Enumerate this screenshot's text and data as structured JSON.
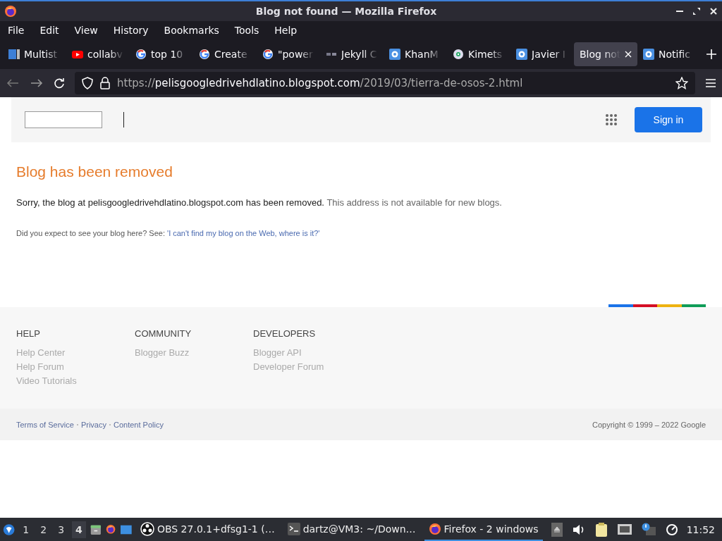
{
  "window": {
    "title": "Blog not found — Mozilla Firefox"
  },
  "menu": [
    "File",
    "Edit",
    "View",
    "History",
    "Bookmarks",
    "Tools",
    "Help"
  ],
  "tabs": [
    {
      "label": "Multist",
      "kind": "tile",
      "selected": false
    },
    {
      "label": "collabv",
      "kind": "play",
      "selected": false
    },
    {
      "label": "top 10",
      "kind": "g",
      "selected": false
    },
    {
      "label": "Create",
      "kind": "g",
      "selected": false
    },
    {
      "label": "\"power",
      "kind": "g",
      "selected": false
    },
    {
      "label": "Jekyll C",
      "kind": "dots",
      "selected": false
    },
    {
      "label": "KhanM",
      "kind": "d",
      "selected": false
    },
    {
      "label": "Kimets",
      "kind": "gear",
      "selected": false
    },
    {
      "label": "Javier I",
      "kind": "d",
      "selected": false
    },
    {
      "label": "Blog not",
      "kind": "none",
      "selected": true
    },
    {
      "label": "Notific",
      "kind": "d",
      "selected": false
    }
  ],
  "address": {
    "scheme": "https://",
    "domain": "pelisgoogledrivehdlatino.blogspot.com",
    "path": "/2019/03/tierra-de-osos-2.html"
  },
  "page": {
    "sign_in": "Sign in",
    "heading": "Blog has been removed",
    "message": "Sorry, the blog at pelisgoogledrivehdlatino.blogspot.com has been removed.",
    "message_note": "This address is not available for new blogs.",
    "help_prompt": "Did you expect to see your blog here? See:",
    "help_link": "'I can't find my blog on the Web, where is it?'",
    "footer_columns": [
      {
        "heading": "HELP",
        "links": [
          "Help Center",
          "Help Forum",
          "Video Tutorials"
        ]
      },
      {
        "heading": "COMMUNITY",
        "links": [
          "Blogger Buzz"
        ]
      },
      {
        "heading": "DEVELOPERS",
        "links": [
          "Blogger API",
          "Developer Forum"
        ]
      }
    ],
    "legal_links": [
      "Terms of Service",
      "Privacy",
      "Content Policy"
    ],
    "copyright": "Copyright © 1999 – 2022 Google"
  },
  "taskbar": {
    "workspaces": [
      {
        "label": "1",
        "selected": false
      },
      {
        "label": "2",
        "selected": false
      },
      {
        "label": "3",
        "selected": false
      },
      {
        "label": "4",
        "selected": true
      }
    ],
    "tasks": [
      {
        "label": "OBS 27.0.1+dfsg1-1 (…",
        "kind": "obs",
        "selected": false
      },
      {
        "label": "dartz@VM3: ~/Down…",
        "kind": "terminal",
        "selected": false
      },
      {
        "label": "Firefox - 2 windows",
        "kind": "firefox",
        "selected": true
      }
    ],
    "clock": "11:52"
  }
}
